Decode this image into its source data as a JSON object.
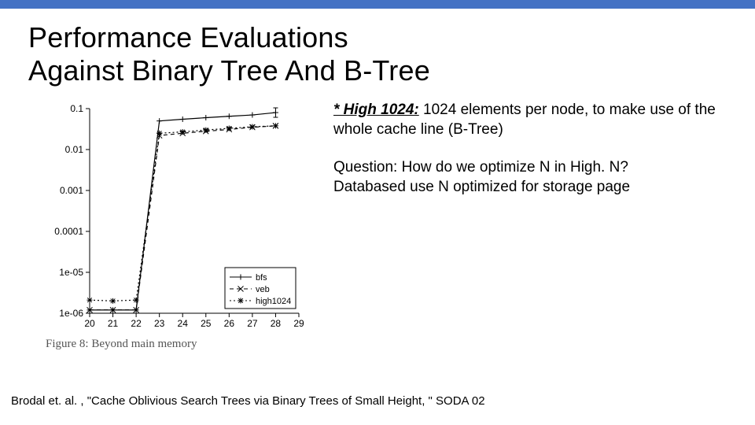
{
  "accent_color": "#4472c4",
  "title": "Performance Evaluations\nAgainst Binary Tree And B-Tree",
  "note1_strong": "* High 1024:",
  "note1_rest": " 1024 elements per node, to make use of the whole cache line (B-Tree)",
  "note2_l1": "Question: How do we optimize N in High. N?",
  "note2_l2": "Databased use N optimized for storage page",
  "chart_data": {
    "type": "line",
    "title": "",
    "xlabel": "",
    "ylabel": "",
    "x": [
      20,
      21,
      22,
      23,
      24,
      25,
      26,
      27,
      28,
      29
    ],
    "ylog": true,
    "ylim": [
      1e-06,
      0.1
    ],
    "xlim": [
      20,
      29
    ],
    "y_ticks": [
      1e-06,
      1e-05,
      0.0001,
      0.001,
      0.01,
      0.1
    ],
    "y_tick_labels": [
      "1e-06",
      "1e-05",
      "0.0001",
      "0.001",
      "0.01",
      "0.1"
    ],
    "x_tick_labels": [
      "20",
      "21",
      "22",
      "23",
      "24",
      "25",
      "26",
      "27",
      "28",
      "29"
    ],
    "series": [
      {
        "name": "bfs",
        "marker": "cross",
        "dash": "solid",
        "values": [
          1.2e-06,
          1.2e-06,
          1.2e-06,
          0.05,
          0.055,
          0.06,
          0.065,
          0.07,
          0.08,
          null
        ]
      },
      {
        "name": "veb",
        "marker": "x",
        "dash": "dash",
        "values": [
          1.2e-06,
          1.2e-06,
          1.2e-06,
          0.022,
          0.025,
          0.028,
          0.031,
          0.035,
          0.038,
          null
        ]
      },
      {
        "name": "high1024",
        "marker": "star",
        "dash": "dot",
        "values": [
          2.1e-06,
          2e-06,
          2.1e-06,
          0.025,
          0.027,
          0.03,
          0.033,
          0.036,
          0.038,
          null
        ]
      }
    ],
    "legend": {
      "position": "bottom-right",
      "entries": [
        "bfs",
        "veb",
        "high1024"
      ]
    },
    "caption": "Figure 8: Beyond main memory"
  },
  "citation": "Brodal et. al. , \"Cache Oblivious Search Trees via Binary Trees of Small Height, \" SODA 02"
}
